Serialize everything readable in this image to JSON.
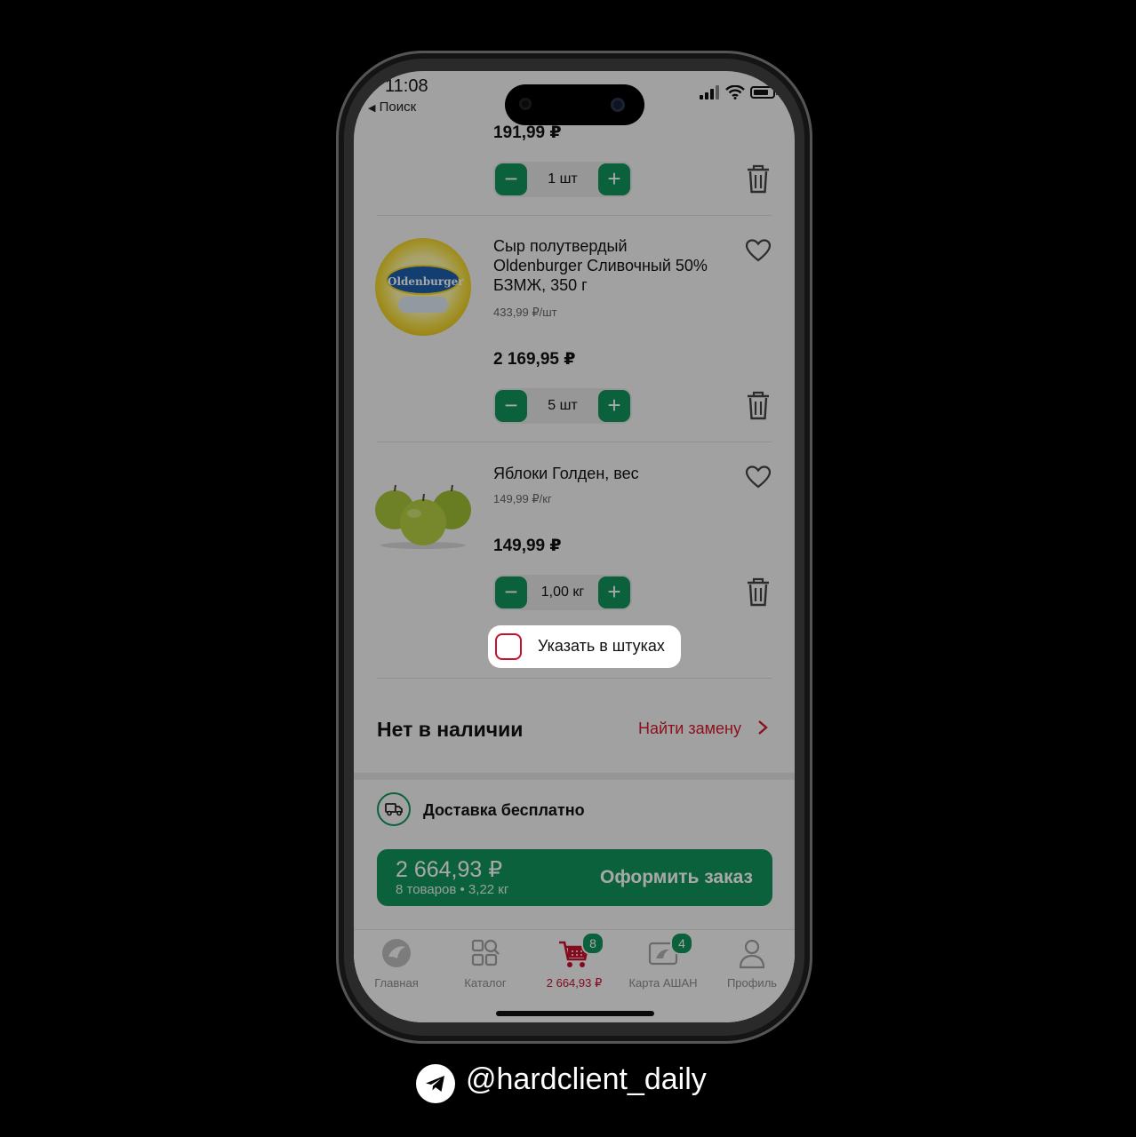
{
  "status_bar": {
    "time": "11:08",
    "back_label": "Поиск"
  },
  "cart": {
    "items": [
      {
        "price": "191,99 ₽",
        "quantity": "1 шт"
      },
      {
        "title_lines": [
          "Сыр полутвердый",
          "Oldenburger Сливочный 50%",
          "БЗМЖ, 350 г"
        ],
        "unit_price": "433,99 ₽/шт",
        "price": "2 169,95 ₽",
        "quantity": "5 шт",
        "image_brand": "Oldenburger"
      },
      {
        "title": "Яблоки Голден, вес",
        "unit_price": "149,99 ₽/кг",
        "price": "149,99 ₽",
        "quantity": "1,00 кг"
      }
    ],
    "pieces_checkbox_label": "Указать в штуках",
    "out_of_stock_title": "Нет в наличии",
    "find_replacement": "Найти замену",
    "delivery_text": "Доставка бесплатно",
    "order": {
      "total": "2 664,93 ₽",
      "meta": "8 товаров • 3,22 кг",
      "label": "Оформить заказ"
    }
  },
  "tabbar": {
    "tabs": [
      {
        "label": "Главная",
        "icon": "home-bird-icon"
      },
      {
        "label": "Каталог",
        "icon": "catalog-search-icon"
      },
      {
        "label": "2 664,93 ₽",
        "icon": "cart-icon",
        "badge": "8",
        "active": true
      },
      {
        "label": "Карта АШАН",
        "icon": "loyalty-card-icon",
        "badge": "4"
      },
      {
        "label": "Профиль",
        "icon": "profile-icon"
      }
    ]
  },
  "footer": {
    "handle": "@hardclient_daily",
    "icon": "telegram-icon"
  },
  "colors": {
    "green": "#11935a",
    "red": "#c8102e",
    "link_red": "#d21b2c"
  }
}
